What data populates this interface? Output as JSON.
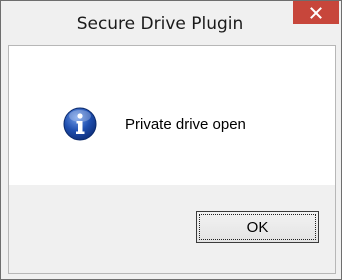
{
  "window": {
    "title": "Secure Drive Plugin",
    "close_icon": "close-icon"
  },
  "dialog": {
    "icon": "info-icon",
    "message": "Private drive open",
    "ok_label": "OK"
  },
  "colors": {
    "close_button": "#c7463b",
    "info_icon_blue": "#1f4fb0",
    "content_background": "#ffffff",
    "chrome_background": "#f0f0f0"
  }
}
